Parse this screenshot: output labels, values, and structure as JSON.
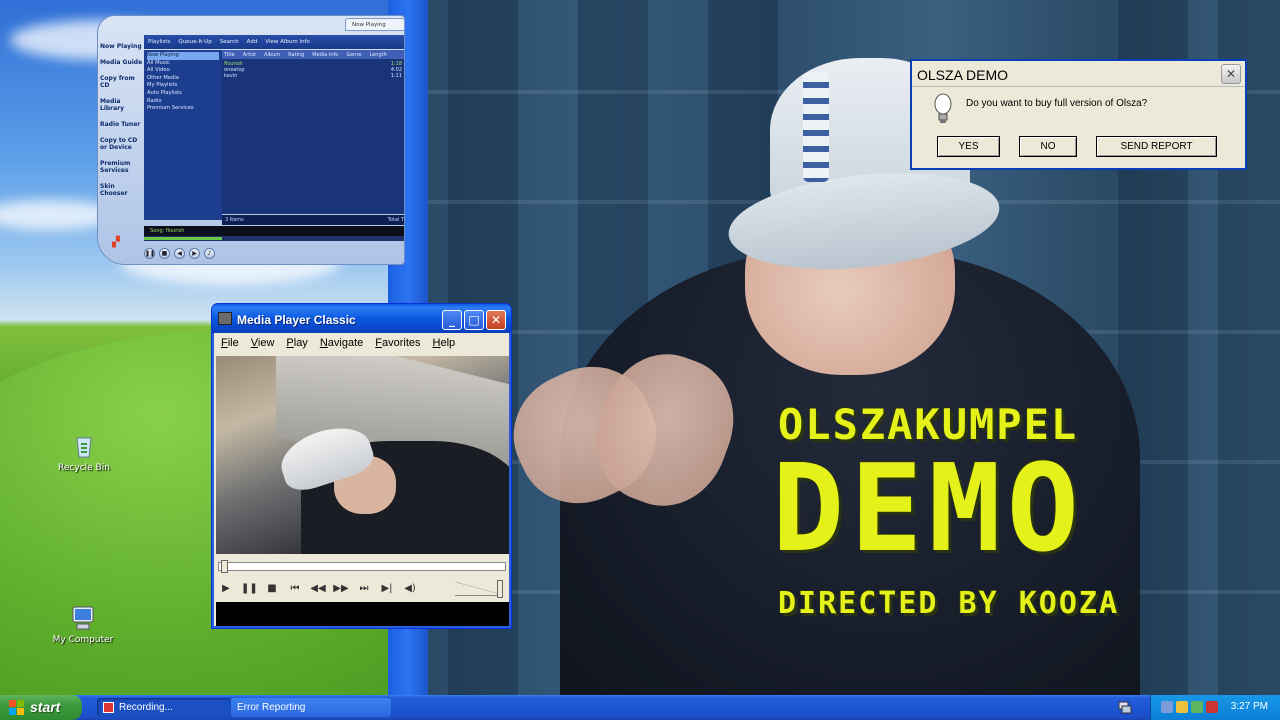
{
  "desktop": {
    "icons": [
      {
        "label": "Recycle Bin"
      },
      {
        "label": "My Computer"
      }
    ]
  },
  "wmp": {
    "now_playing_tab": "Now Playing",
    "taskpane": [
      "Now Playing",
      "Media Guide",
      "Copy from CD",
      "Media Library",
      "Radio Tuner",
      "Copy to CD or Device",
      "Premium Services",
      "Skin Chooser"
    ],
    "toolbar": [
      "Playlists",
      "Queue-It-Up",
      "Search",
      "Add",
      "View Album Info"
    ],
    "tree": [
      "Now Playing",
      "All Music",
      "All Video",
      "Other Media",
      "My Playlists",
      "Auto Playlists",
      "Radio",
      "Premium Services"
    ],
    "columns": [
      "Title",
      "Artist",
      "Album",
      "Rating",
      "Media Info",
      "Genre",
      "Length"
    ],
    "rows": [
      {
        "title": "flourish",
        "length": "1:18"
      },
      {
        "title": "oneatop",
        "length": "4:02"
      },
      {
        "title": "kevin",
        "length": "1:11"
      }
    ],
    "status_left": "3 Items",
    "status_right": "Total T",
    "song": "Song: flourish"
  },
  "mpc": {
    "title": "Media Player Classic",
    "menu": [
      "File",
      "View",
      "Play",
      "Navigate",
      "Favorites",
      "Help"
    ]
  },
  "dialog": {
    "title": "OLSZA DEMO",
    "message": "Do you want to buy full version of Olsza?",
    "buttons": {
      "yes": "YES",
      "no": "NO",
      "report": "SEND REPORT"
    }
  },
  "overlay": {
    "line1": "OLSZAKUMPEL",
    "line2": "DEMO",
    "line3": "DIRECTED BY KOOZA"
  },
  "taskbar": {
    "start": "start",
    "tasks": [
      "Recording...",
      "Error Reporting"
    ],
    "clock": "3:27 PM"
  },
  "colors": {
    "overlay_text": "#e5f219",
    "xp_blue": "#245edb",
    "start_green": "#3c9b3c"
  }
}
